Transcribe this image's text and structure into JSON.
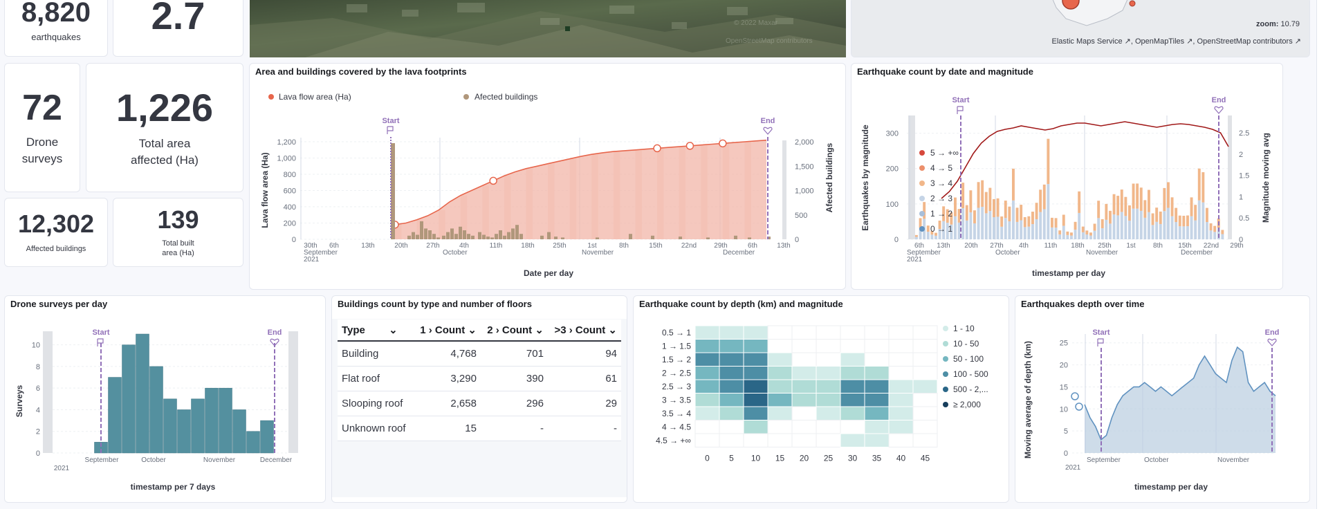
{
  "metrics": {
    "earthquakes_value": "8,820",
    "earthquakes_label": "earthquakes",
    "magnitude_value": "2.7",
    "drone_value": "72",
    "drone_label_1": "Drone",
    "drone_label_2": "surveys",
    "area_value": "1,226",
    "area_label_1": "Total area",
    "area_label_2": "affected (Ha)",
    "buildings_value": "12,302",
    "buildings_label": "Affected buildings",
    "built_value": "139",
    "built_label_1": "Total built",
    "built_label_2": "area (Ha)"
  },
  "map_top": {
    "attribution_faint_1": "© 2022 Maxar",
    "attribution_faint_2": "OpenStreetMap contributors"
  },
  "map_right": {
    "zoom_label": "zoom:",
    "zoom_value": "10.79",
    "attr_1": "Elastic Maps Service",
    "attr_2": "OpenMapTiles",
    "attr_3": "OpenStreetMap contributors"
  },
  "colors": {
    "lava": "#e7664c",
    "lava_fill": "#f2b6a8",
    "buildings_bar": "#b0977b",
    "annotation": "#9170b8",
    "teal": "#54909f",
    "mag_0_1": "#6092c0",
    "mag_1_2": "#a8bfda",
    "mag_2_3": "#c5d4e6",
    "mag_3_4": "#f1b78a",
    "mag_4_5": "#ec8f6b",
    "mag_5_plus": "#d6483c",
    "mag_avg_line": "#a01818"
  },
  "lava_panel": {
    "title": "Area and buildings covered by the lava footprints",
    "legend_lava": "Lava flow area (Ha)",
    "legend_buildings": "Afected buildings",
    "start_label": "Start",
    "end_label": "End",
    "y_left_label": "Lava flow area (Ha)",
    "y_right_label": "Afected buildings",
    "x_label": "Date per day",
    "y_left_ticks": [
      "0",
      "200",
      "400",
      "600",
      "800",
      "1,000",
      "1,200"
    ],
    "y_right_ticks": [
      "0",
      "500",
      "1,000",
      "1,500",
      "2,000"
    ],
    "x_ticks": [
      "30th",
      "6th",
      "13th",
      "20th",
      "27th",
      "4th",
      "11th",
      "18th",
      "25th",
      "1st",
      "8th",
      "15th",
      "22nd",
      "29th",
      "6th",
      "13th"
    ],
    "month_labels": [
      "September",
      "October",
      "November",
      "December"
    ],
    "year_label": "2021"
  },
  "eq_panel": {
    "title": "Earthquake count by date and magnitude",
    "start_label": "Start",
    "end_label": "End",
    "y_left_label": "Earthquakes by magnitude",
    "y_right_label": "Magnitude moving avg",
    "x_label": "timestamp per day",
    "y_left_ticks": [
      "0",
      "100",
      "200",
      "300"
    ],
    "y_right_ticks": [
      "0",
      "0.5",
      "1",
      "1.5",
      "2",
      "2.5"
    ],
    "x_ticks": [
      "6th",
      "13th",
      "20th",
      "27th",
      "4th",
      "11th",
      "18th",
      "25th",
      "1st",
      "8th",
      "15th",
      "22nd",
      "29th",
      "6th"
    ],
    "month_labels": [
      "September",
      "October",
      "November",
      "December"
    ],
    "year_label": "2021",
    "legend": [
      "5 → +∞",
      "4 → 5",
      "3 → 4",
      "2 → 3",
      "1 → 2",
      "0 → 1"
    ]
  },
  "drone_panel": {
    "title": "Drone surveys per day",
    "start_label": "Start",
    "end_label": "End",
    "y_label": "Surveys",
    "x_label": "timestamp per 7 days",
    "y_ticks": [
      "0",
      "2",
      "4",
      "6",
      "8",
      "10"
    ],
    "month_labels": [
      "September",
      "October",
      "November",
      "December"
    ],
    "year_label": "2021"
  },
  "buildings_panel": {
    "title": "Buildings count by type and number of floors",
    "headers": [
      "Type",
      "1 › Count",
      "2 › Count",
      ">3 › Count"
    ],
    "rows": [
      [
        "Building",
        "4,768",
        "701",
        "94"
      ],
      [
        "Flat roof",
        "3,290",
        "390",
        "61"
      ],
      [
        "Slooping roof",
        "2,658",
        "296",
        "29"
      ],
      [
        "Unknown roof",
        "15",
        "-",
        "-"
      ]
    ]
  },
  "heatmap_panel": {
    "title": "Earthquake count by depth (km) and magnitude",
    "y_labels": [
      "0.5 → 1",
      "1 → 1.5",
      "1.5 → 2",
      "2 → 2.5",
      "2.5 → 3",
      "3 → 3.5",
      "3.5 → 4",
      "4 → 4.5",
      "4.5 → +∞"
    ],
    "x_labels": [
      "0",
      "5",
      "10",
      "15",
      "20",
      "25",
      "30",
      "35",
      "40",
      "45"
    ],
    "legend": [
      "1 - 10",
      "10 - 50",
      "50 - 100",
      "100 - 500",
      "500 - 2,...",
      "≥ 2,000"
    ]
  },
  "depth_panel": {
    "title": "Earthquakes depth over time",
    "start_label": "Start",
    "end_label": "End",
    "y_label": "Moving average of depth (km)",
    "x_label": "timestamp per day",
    "y_ticks": [
      "0",
      "5",
      "10",
      "15",
      "20",
      "25"
    ],
    "month_labels": [
      "September",
      "October",
      "November"
    ],
    "year_label": "2021"
  },
  "chart_data": [
    {
      "type": "bar",
      "title": "Drone surveys per day",
      "xlabel": "timestamp per 7 days",
      "ylabel": "Surveys",
      "ylim": [
        0,
        11
      ],
      "values": [
        1,
        7,
        10,
        11,
        8,
        5,
        4,
        5,
        6,
        6,
        4,
        2,
        3
      ]
    },
    {
      "type": "heatmap",
      "title": "Earthquake count by depth (km) and magnitude",
      "rows": [
        "0.5 → 1",
        "1 → 1.5",
        "1.5 → 2",
        "2 → 2.5",
        "2.5 → 3",
        "3 → 3.5",
        "3.5 → 4",
        "4 → 4.5",
        "4.5 → +∞"
      ],
      "cols": [
        "0",
        "5",
        "10",
        "15",
        "20",
        "25",
        "30",
        "35",
        "40",
        "45"
      ],
      "buckets": [
        [
          1,
          1,
          1,
          0,
          0,
          0,
          0,
          0,
          0,
          0
        ],
        [
          3,
          3,
          3,
          0,
          0,
          0,
          0,
          0,
          0,
          0
        ],
        [
          4,
          4,
          4,
          1,
          0,
          0,
          1,
          0,
          0,
          0
        ],
        [
          3,
          4,
          4,
          2,
          1,
          1,
          2,
          2,
          0,
          0
        ],
        [
          3,
          4,
          5,
          2,
          2,
          2,
          4,
          4,
          1,
          1
        ],
        [
          2,
          3,
          5,
          3,
          2,
          2,
          4,
          4,
          1,
          0
        ],
        [
          1,
          2,
          4,
          1,
          0,
          1,
          2,
          3,
          1,
          0
        ],
        [
          0,
          0,
          2,
          0,
          0,
          0,
          0,
          1,
          1,
          0
        ],
        [
          0,
          0,
          0,
          0,
          0,
          0,
          1,
          1,
          0,
          0
        ]
      ]
    },
    {
      "type": "area",
      "title": "Earthquakes depth over time",
      "ylabel": "Moving average of depth (km)",
      "xlabel": "timestamp per day",
      "ylim": [
        0,
        27
      ],
      "values": [
        11,
        8,
        6,
        3,
        4,
        8,
        11,
        13,
        14,
        15,
        15,
        16,
        15,
        14,
        15,
        14,
        13,
        14,
        15,
        16,
        17,
        20,
        22,
        20,
        18,
        17,
        16,
        21,
        24,
        23,
        16,
        14,
        15,
        16,
        14,
        13
      ]
    },
    {
      "type": "area",
      "title": "Area and buildings covered by the lava footprints",
      "ylabel": "Lava flow area (Ha)",
      "xlabel": "Date per day",
      "ylim": [
        0,
        1200
      ],
      "values": [
        180,
        200,
        240,
        290,
        360,
        460,
        540,
        600,
        660,
        720,
        780,
        830,
        870,
        900,
        930,
        960,
        990,
        1020,
        1045,
        1065,
        1080,
        1090,
        1100,
        1110,
        1120,
        1130,
        1140,
        1150,
        1160,
        1170,
        1180,
        1190,
        1200,
        1210,
        1220
      ]
    },
    {
      "type": "bar",
      "title": "Earthquake count by date and magnitude",
      "xlabel": "timestamp per day",
      "ylabel": "Earthquakes by magnitude",
      "ylim": [
        0,
        350
      ],
      "values": [
        20,
        60,
        150,
        40,
        30,
        20,
        60,
        110,
        90,
        100,
        120,
        130,
        160,
        150,
        140,
        110,
        170,
        200,
        150,
        160,
        140,
        120,
        90,
        110,
        150,
        200,
        130,
        100,
        80,
        70,
        90,
        120,
        150,
        200,
        290,
        90,
        60,
        40,
        70,
        30
      ]
    }
  ]
}
